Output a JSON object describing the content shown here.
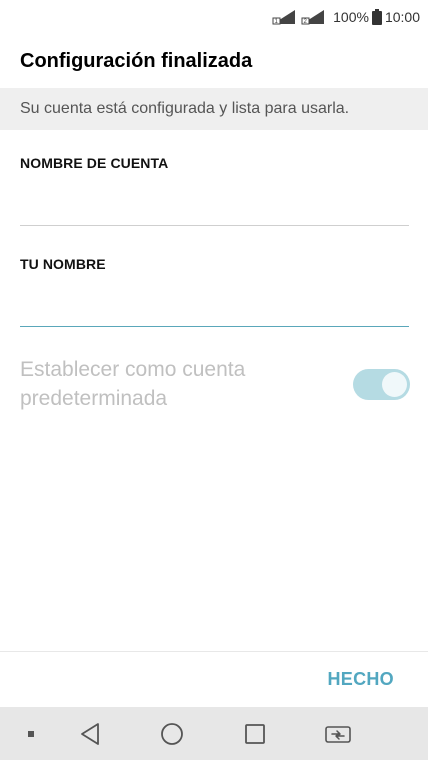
{
  "status_bar": {
    "battery_percent": "100%",
    "time": "10:00",
    "icons": [
      "sim1-signal-icon",
      "sim2-signal-icon",
      "battery-icon"
    ]
  },
  "header": {
    "title": "Configuración finalizada"
  },
  "subheader": {
    "text": "Su cuenta está configurada y lista para usarla."
  },
  "form": {
    "account_name_label": "NOMBRE DE CUENTA",
    "account_name_value": "",
    "your_name_label": "TU NOMBRE",
    "your_name_value": "",
    "default_account_label": "Establecer como cuenta predeterminada",
    "default_account_toggle_on": true
  },
  "actions": {
    "done_label": "HECHO"
  },
  "nav_bar": {
    "icons": [
      "notification-dot-icon",
      "back-icon",
      "home-icon",
      "recents-icon",
      "dual-window-icon"
    ]
  },
  "colors": {
    "accent": "#52a7c0",
    "toggle_track": "#b5dbe3",
    "subheader_bg": "#efefef",
    "nav_bg": "#e7e7e7"
  }
}
